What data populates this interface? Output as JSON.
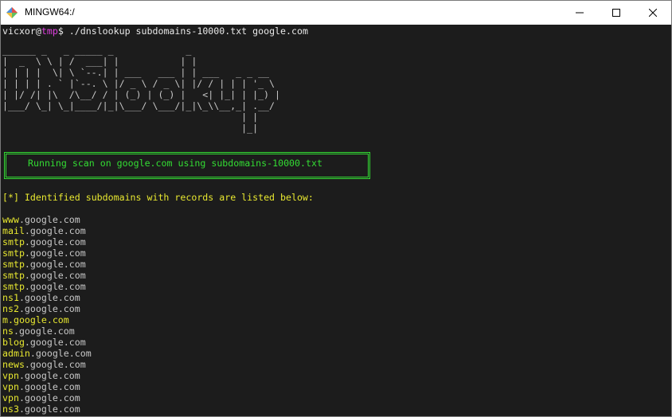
{
  "window": {
    "title": "MINGW64:/",
    "icon": "git-bash-icon",
    "controls": {
      "minimize": "—",
      "maximize": "☐",
      "close": "✕"
    }
  },
  "prompt": {
    "user": "vicxor",
    "at": "@",
    "dir": "tmp",
    "symbol": "$",
    "command": " ./dnslookup subdomains-10000.txt google.com"
  },
  "banner": [
    "______ _   _ _____ _             _",
    "|  _  \\ \\ | /  ___| |           | |",
    "| | | |  \\| \\ `--.| | ___   ___ | | ___   _ _ __",
    "| | | | . ` |`--. \\ |/ _ \\ / _ \\| |/ / | | | '_ \\",
    "| |/ /| |\\  /\\__/ / | (_) | (_) |   <| |_| | |_) |",
    "|___/ \\_| \\_|____/|_|\\___/ \\___/|_|\\_\\\\__,_| .__/",
    "                                           | |",
    "                                           |_|"
  ],
  "scan_message": "Running scan on google.com using subdomains-10000.txt",
  "identified": {
    "marker": "[*]",
    "text": " Identified subdomains with records are listed below:"
  },
  "subdomains": [
    {
      "prefix": "www",
      "domain": ".google.com"
    },
    {
      "prefix": "mail",
      "domain": ".google.com"
    },
    {
      "prefix": "smtp",
      "domain": ".google.com"
    },
    {
      "prefix": "smtp",
      "domain": ".google.com"
    },
    {
      "prefix": "smtp",
      "domain": ".google.com"
    },
    {
      "prefix": "smtp",
      "domain": ".google.com"
    },
    {
      "prefix": "smtp",
      "domain": ".google.com"
    },
    {
      "prefix": "ns1",
      "domain": ".google.com"
    },
    {
      "prefix": "ns2",
      "domain": ".google.com"
    },
    {
      "prefix": "m",
      "domain": ".google.com"
    },
    {
      "prefix": "ns",
      "domain": ".google.com"
    },
    {
      "prefix": "blog",
      "domain": ".google.com"
    },
    {
      "prefix": "admin",
      "domain": ".google.com"
    },
    {
      "prefix": "news",
      "domain": ".google.com"
    },
    {
      "prefix": "vpn",
      "domain": ".google.com"
    },
    {
      "prefix": "vpn",
      "domain": ".google.com"
    },
    {
      "prefix": "vpn",
      "domain": ".google.com"
    },
    {
      "prefix": "ns3",
      "domain": ".google.com"
    }
  ]
}
